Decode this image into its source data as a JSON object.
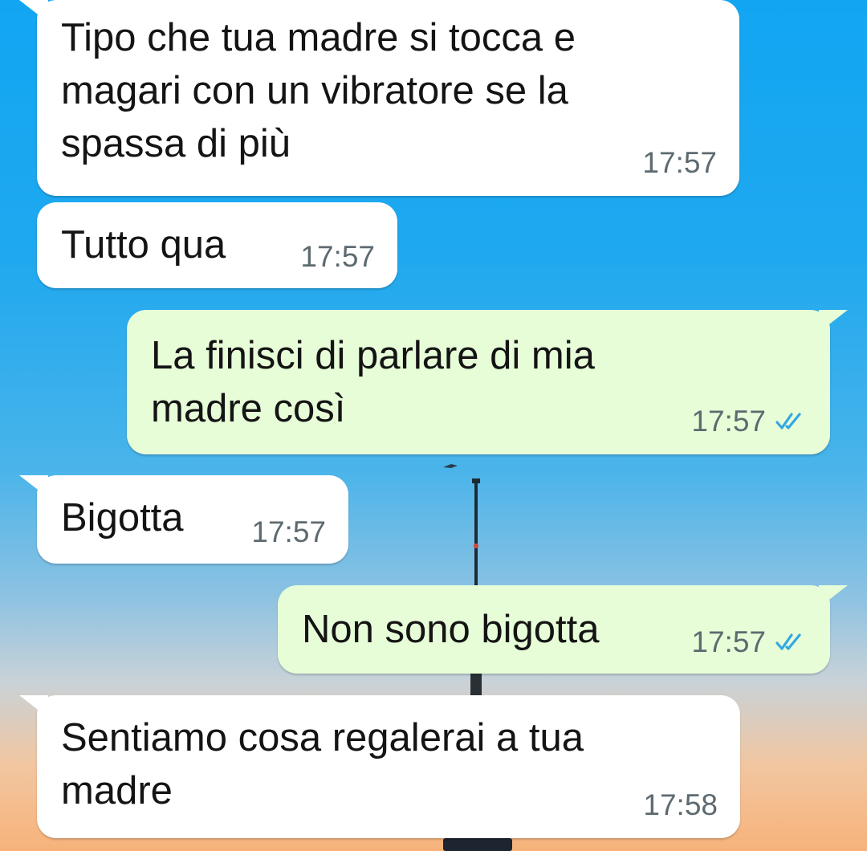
{
  "colors": {
    "incoming_bubble": "#ffffff",
    "outgoing_bubble": "#e7fdd8",
    "timestamp": "#5d6a70",
    "read_ticks": "#34a7e2"
  },
  "chat": {
    "messages": [
      {
        "direction": "incoming",
        "text": "Tipo che tua madre si tocca e\nmagari con un vibratore se la\nspassa di più",
        "time": "17:57"
      },
      {
        "direction": "incoming",
        "text": "Tutto qua",
        "time": "17:57"
      },
      {
        "direction": "outgoing",
        "text": "La finisci di parlare di mia\nmadre così",
        "time": "17:57",
        "status_icon": "double-check-read-icon"
      },
      {
        "direction": "incoming",
        "text": "Bigotta",
        "time": "17:57"
      },
      {
        "direction": "outgoing",
        "text": "Non sono bigotta",
        "time": "17:57",
        "status_icon": "double-check-read-icon"
      },
      {
        "direction": "incoming",
        "text": "Sentiamo cosa regalerai a tua\nmadre",
        "time": "17:58"
      }
    ]
  }
}
